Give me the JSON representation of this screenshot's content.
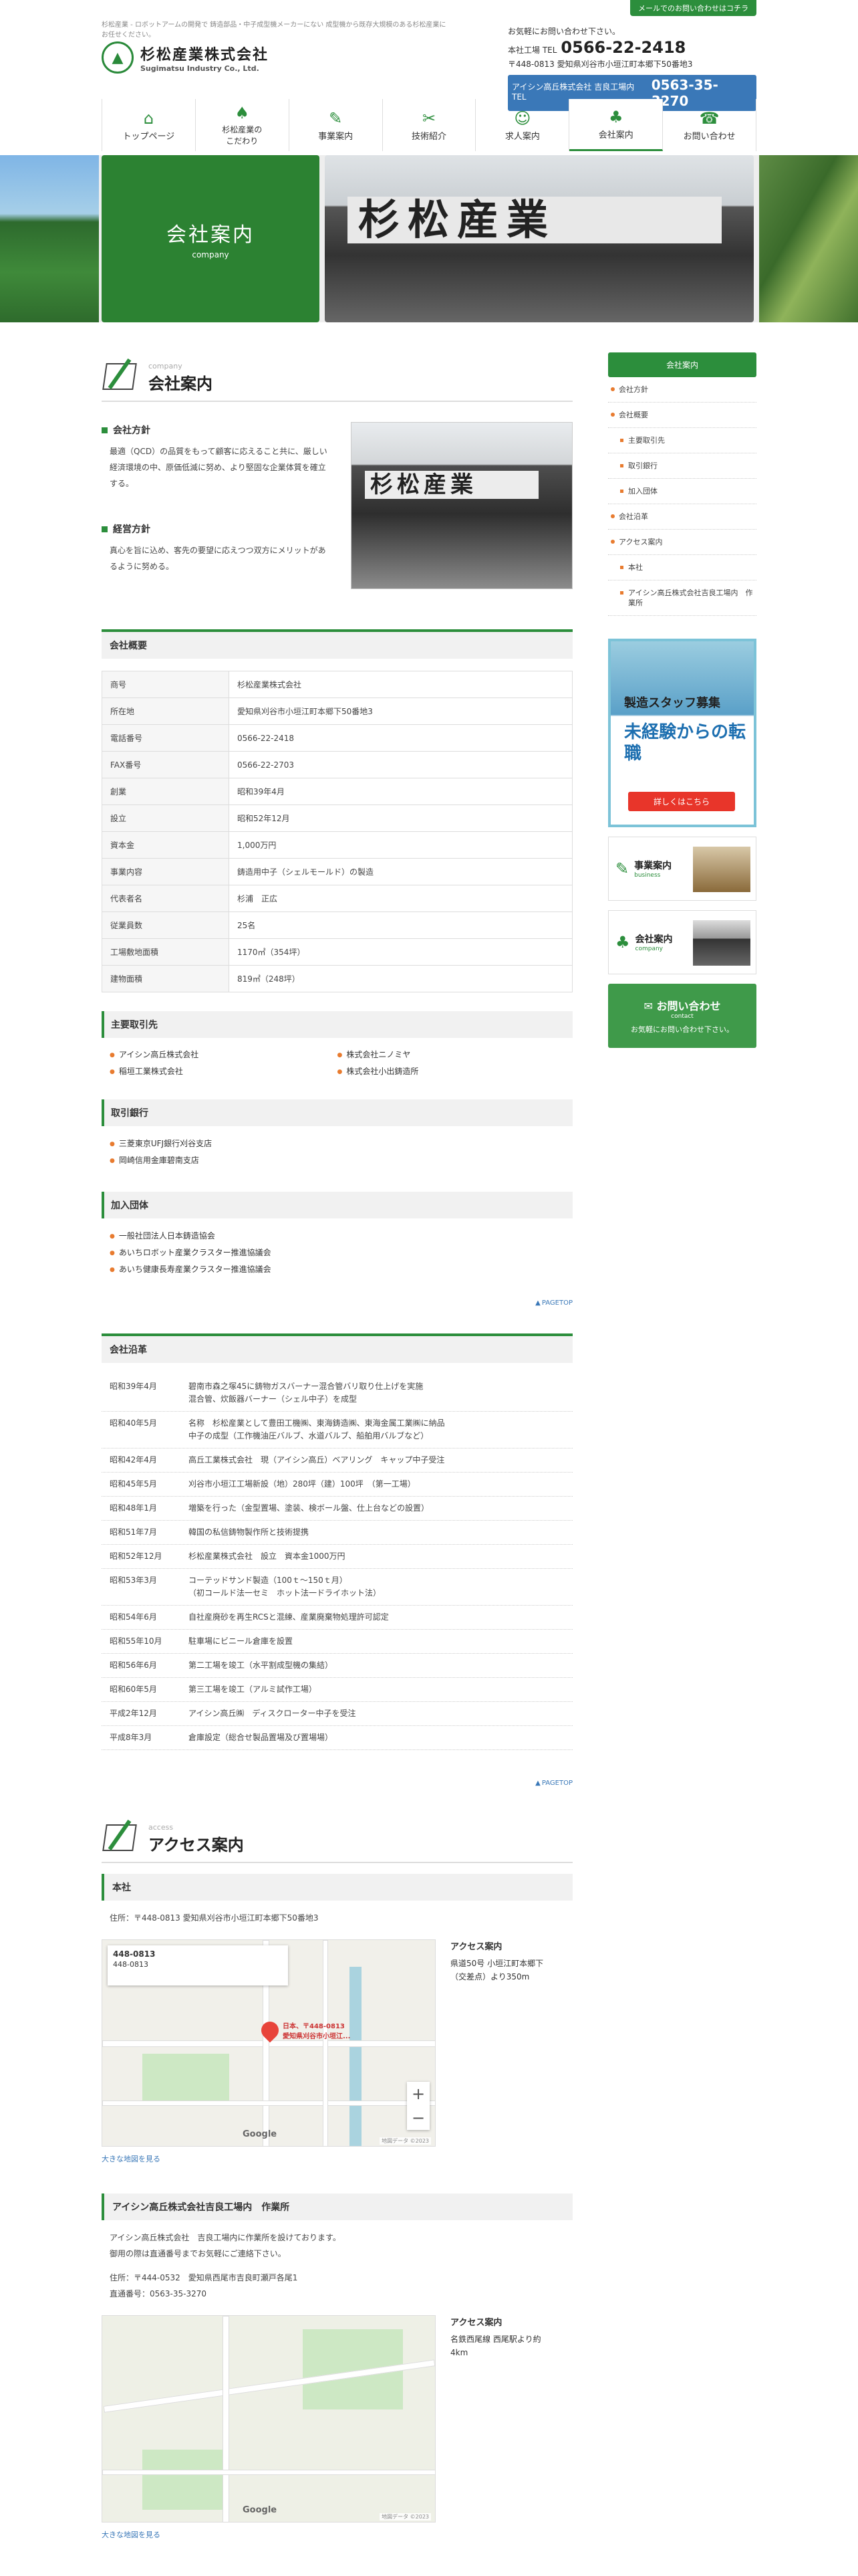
{
  "header": {
    "tagline": "杉松産業 - ロボットアームの開発で 鋳造部品・中子成型機メーカーにない 成型機から既存大規模のある杉松産業にお任せください。",
    "logo_jp": "杉松産業株式会社",
    "logo_en": "Sugimatsu Industry Co., Ltd.",
    "mail_btn": "メールでのお問い合わせはコチラ",
    "contact_lead": "お気軽にお問い合わせ下さい。",
    "honsha_label": "本社工場 TEL",
    "honsha_tel": "0566-22-2418",
    "address": "〒448-0813 愛知県刈谷市小垣江町本郷下50番地3",
    "aisin_label": "アイシン高丘株式会社 吉良工場内 TEL",
    "aisin_tel": "0563-35-3270"
  },
  "nav": [
    {
      "label": "トップページ",
      "icon": "home-icon"
    },
    {
      "label": "杉松産業の\nこだわり",
      "icon": "tree-icon"
    },
    {
      "label": "事業案内",
      "icon": "edit-icon"
    },
    {
      "label": "技術紹介",
      "icon": "tools-icon"
    },
    {
      "label": "求人案内",
      "icon": "people-icon"
    },
    {
      "label": "会社案内",
      "icon": "factory-icon"
    },
    {
      "label": "お問い合わせ",
      "icon": "phone-icon"
    }
  ],
  "hero": {
    "title": "会社案内",
    "sub": "company",
    "sign": "杉松産業"
  },
  "page": {
    "title_en": "company",
    "title_jp": "会社案内",
    "policy_title": "会社方針",
    "policy_text": "最適（QCD）の品質をもって顧客に応えること共に、厳しい経済環境の中、原価低減に努め、より堅固な企業体質を確立する。",
    "biz_title": "経営方針",
    "biz_text": "真心を旨に込め、客先の要望に応えつつ双方にメリットがあるように努める。",
    "overview_title": "会社概要",
    "overview": [
      {
        "k": "商号",
        "v": "杉松産業株式会社"
      },
      {
        "k": "所在地",
        "v": "愛知県刈谷市小垣江町本郷下50番地3"
      },
      {
        "k": "電話番号",
        "v": "0566-22-2418"
      },
      {
        "k": "FAX番号",
        "v": "0566-22-2703"
      },
      {
        "k": "創業",
        "v": "昭和39年4月"
      },
      {
        "k": "設立",
        "v": "昭和52年12月"
      },
      {
        "k": "資本金",
        "v": "1,000万円"
      },
      {
        "k": "事業内容",
        "v": "鋳造用中子（シェルモールド）の製造"
      },
      {
        "k": "代表者名",
        "v": "杉浦　正広"
      },
      {
        "k": "従業員数",
        "v": "25名"
      },
      {
        "k": "工場敷地面積",
        "v": "1170㎡（354坪）"
      },
      {
        "k": "建物面積",
        "v": "819㎡（248坪）"
      }
    ],
    "clients_title": "主要取引先",
    "clients": [
      "アイシン高丘株式会社",
      "株式会社ニノミヤ",
      "稲垣工業株式会社",
      "株式会社小出鋳造所"
    ],
    "banks_title": "取引銀行",
    "banks": [
      "三菱東京UFJ銀行刈谷支店",
      "岡崎信用金庫碧南支店"
    ],
    "assoc_title": "加入団体",
    "assoc": [
      "一般社団法人日本鋳造協会",
      "あいちロボット産業クラスター推進協議会",
      "あいち健康長寿産業クラスター推進協議会"
    ],
    "pagetop": "PAGETOP",
    "history_title": "会社沿革",
    "history": [
      {
        "d": "昭和39年4月",
        "e": "碧南市森之塚45に鋳物ガスバーナー混合管バリ取り仕上げを実施\n混合管、炊飯器バーナー（シェル中子）を成型"
      },
      {
        "d": "昭和40年5月",
        "e": "名称　杉松産業として豊田工機㈱、東海鋳造㈱、東海金属工業㈱に納品\n中子の成型（工作機油圧バルブ、水道バルブ、船舶用バルブなど）"
      },
      {
        "d": "昭和42年4月",
        "e": "高丘工業株式会社　現（アイシン高丘）ベアリング　キャップ中子受注"
      },
      {
        "d": "昭和45年5月",
        "e": "刈谷市小垣江工場新設（地）280坪（建）100坪　（第一工場）"
      },
      {
        "d": "昭和48年1月",
        "e": "増築を行った（金型置場、塗装、検ボール盤、仕上台などの設置）"
      },
      {
        "d": "昭和51年7月",
        "e": "韓国の私信鋳物製作所と技術提携"
      },
      {
        "d": "昭和52年12月",
        "e": "杉松産業株式会社　設立　資本金1000万円"
      },
      {
        "d": "昭和53年3月",
        "e": "コーテッドサンド製造（100ｔ～150ｔ月）\n（初コールド法一セミ　ホット法一ドライホット法）"
      },
      {
        "d": "昭和54年6月",
        "e": "自社産廃砂を再生RCSと混練、産業廃棄物処理許可認定"
      },
      {
        "d": "昭和55年10月",
        "e": "駐車場にビニール倉庫を設置"
      },
      {
        "d": "昭和56年6月",
        "e": "第二工場を竣工（水平割成型機の集結）"
      },
      {
        "d": "昭和60年5月",
        "e": "第三工場を竣工（アルミ試作工場）"
      },
      {
        "d": "平成2年12月",
        "e": "アイシン高丘㈱　ディスクローター中子を受注"
      },
      {
        "d": "平成8年3月",
        "e": "倉庫設定（総合せ製品置場及び置場場）"
      }
    ],
    "access_en": "access",
    "access_jp": "アクセス案内",
    "hq_title": "本社",
    "hq_addr": "住所：〒448-0813 愛知県刈谷市小垣江町本郷下50番地3",
    "map1_info_title": "448-0813",
    "map1_info_sub": "448-0813",
    "map1_pin": "日本、〒448-0813\n愛知県刈谷市小垣江...",
    "map1_note_title": "アクセス案内",
    "map1_note": "県道50号 小垣江町本郷下\n（交差点）より350m",
    "map_link": "大きな地図を見る",
    "aisin_title": "アイシン高丘株式会社吉良工場内　作業所",
    "aisin_text1": "アイシン高丘株式会社　吉良工場内に作業所を設けております。",
    "aisin_text2": "御用の際は直通番号までお気軽にご連絡下さい。",
    "aisin_addr": "住所：〒444-0532　愛知県西尾市吉良町瀬戸各尾1",
    "aisin_tel": "直通番号：0563-35-3270",
    "map2_note_title": "アクセス案内",
    "map2_note": "名鉄西尾線 西尾駅より約4km",
    "google": "Google",
    "map_copy": "地図データ ©2023"
  },
  "side": {
    "head": "会社案内",
    "menu": [
      {
        "label": "会社方針",
        "sub": false
      },
      {
        "label": "会社概要",
        "sub": false
      },
      {
        "label": "主要取引先",
        "sub": true
      },
      {
        "label": "取引銀行",
        "sub": true
      },
      {
        "label": "加入団体",
        "sub": true
      },
      {
        "label": "会社沿革",
        "sub": false
      },
      {
        "label": "アクセス案内",
        "sub": false
      },
      {
        "label": "本社",
        "sub": true
      },
      {
        "label": "アイシン高丘株式会社吉良工場内　作業所",
        "sub": true
      }
    ],
    "recruit_t1": "製造スタッフ募集",
    "recruit_t2": "未経験からの転職",
    "recruit_btn": "詳しくはこちら",
    "bn1_t": "事業案内",
    "bn1_e": "business",
    "bn2_t": "会社案内",
    "bn2_e": "company",
    "contact_t": "お問い合わせ",
    "contact_e": "contact",
    "contact_s": "お気軽にお問い合わせ下さい。"
  },
  "colors": {
    "accent": "#2c8e3c",
    "orange": "#e87b2f",
    "blue": "#3a78b8"
  }
}
